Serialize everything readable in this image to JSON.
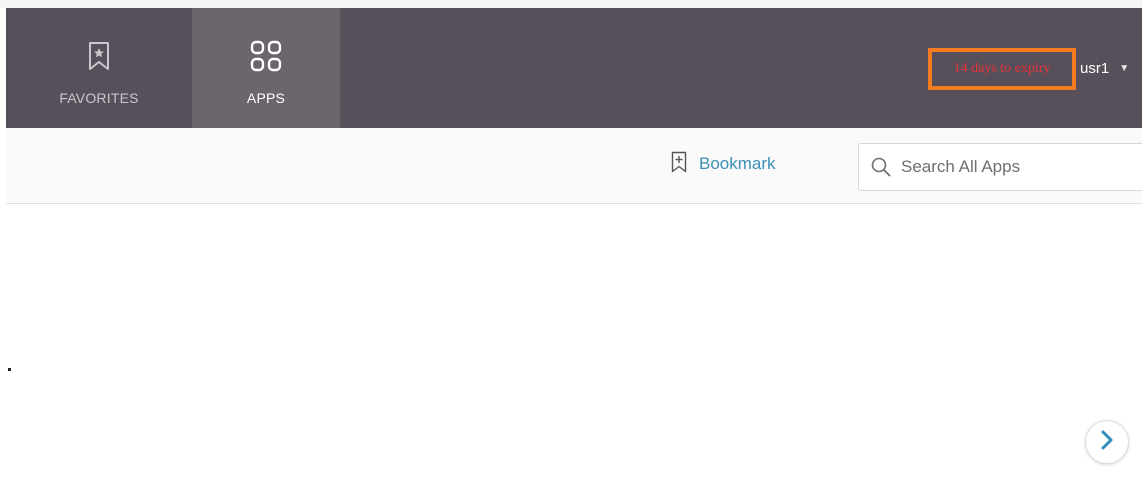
{
  "nav": {
    "tabs": [
      {
        "label": "FAVORITES",
        "icon": "bookmark-star-icon",
        "active": false
      },
      {
        "label": "APPS",
        "icon": "apps-grid-icon",
        "active": true
      }
    ]
  },
  "header": {
    "expiry_notice": "14 days to expiry",
    "user_name": "usr1",
    "user_caret": "▼"
  },
  "toolbar": {
    "bookmark_label": "Bookmark",
    "search_placeholder": "Search All Apps",
    "search_value": ""
  },
  "colors": {
    "topbar": "#574f59",
    "active_tab": "#6c656e",
    "highlight_border": "#f37b20",
    "expiry_text": "#e53238",
    "link": "#3d8fb5",
    "scroll_arrow": "#2f8cbf"
  },
  "icons": {
    "favorites": "bookmark-star-icon",
    "apps": "apps-grid-icon",
    "bookmark": "bookmark-plus-icon",
    "search": "search-icon",
    "next": "chevron-right-icon"
  }
}
